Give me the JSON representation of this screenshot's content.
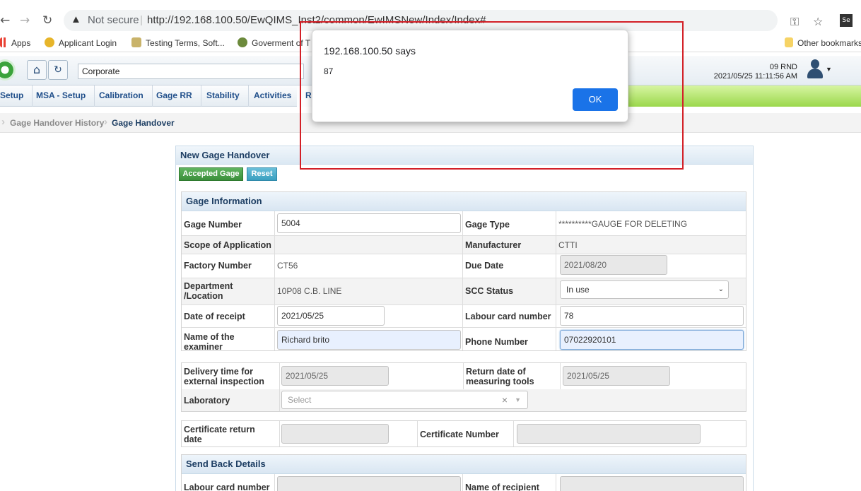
{
  "browser": {
    "security_label": "Not secure",
    "url": "http://192.168.100.50/EwQIMS_Inst2/common/EwIMSNew/Index/Index#",
    "bookmarks": [
      "Apps",
      "Applicant Login",
      "Testing Terms, Soft...",
      "Goverment of T"
    ],
    "other_bookmarks": "Other bookmarks"
  },
  "header": {
    "company": "Corporate",
    "user_code": "09 RND",
    "datetime": "2021/05/25 11:11:56 AM"
  },
  "menu": [
    "Setup",
    "MSA - Setup",
    "Calibration",
    "Gage RR",
    "Stability",
    "Activities",
    "R"
  ],
  "breadcrumb": [
    "Gage Handover History",
    "Gage Handover"
  ],
  "panel": {
    "title": "New Gage Handover",
    "accept_label": "Accepted Gage",
    "reset_label": "Reset"
  },
  "gage_info": {
    "section_title": "Gage Information",
    "gage_number_label": "Gage Number",
    "gage_number": "5004",
    "gage_type_label": "Gage Type",
    "gage_type": "**********GAUGE FOR DELETING",
    "scope_label": "Scope of Application",
    "scope": "",
    "manufacturer_label": "Manufacturer",
    "manufacturer": "CTTI",
    "factory_number_label": "Factory Number",
    "factory_number": "CT56",
    "due_date_label": "Due Date",
    "due_date": "2021/08/20",
    "department_label": "Department /Location",
    "department": "10P08 C.B. LINE",
    "scc_status_label": "SCC Status",
    "scc_status": "In use",
    "date_receipt_label": "Date of receipt",
    "date_receipt": "2021/05/25",
    "labour_card_label": "Labour card number",
    "labour_card": "78",
    "examiner_label": "Name of the examiner",
    "examiner": "Richard brito",
    "phone_label": "Phone Number",
    "phone": "07022920101"
  },
  "delivery": {
    "delivery_time_label": "Delivery time for external inspection",
    "delivery_time": "2021/05/25",
    "return_date_label": "Return date of measuring tools",
    "return_date": "2021/05/25",
    "laboratory_label": "Laboratory",
    "laboratory_placeholder": "Select"
  },
  "certificate": {
    "return_date_label": "Certificate return date",
    "number_label": "Certificate Number"
  },
  "send_back": {
    "section_title": "Send Back Details",
    "labour_card_label": "Labour card number",
    "recipient_label": "Name of recipient"
  },
  "dialog": {
    "title": "192.168.100.50 says",
    "message": "87",
    "ok_label": "OK"
  },
  "colors": {
    "accent_blue": "#1a73e8",
    "menu_green": "#9bd84c",
    "highlight_red": "#d32027"
  }
}
